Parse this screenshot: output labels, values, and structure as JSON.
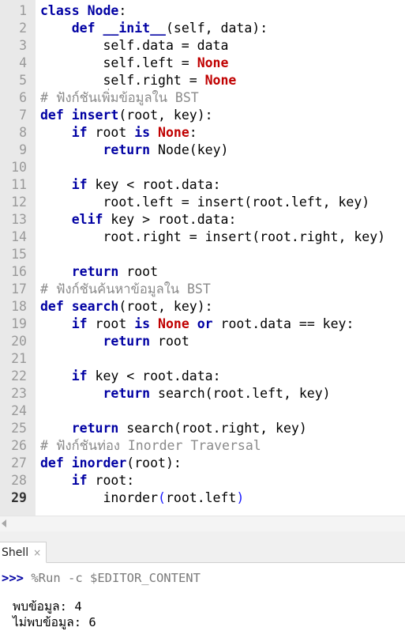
{
  "editor": {
    "current_line": 29,
    "lines": [
      {
        "n": 1,
        "tokens": [
          {
            "t": "class",
            "c": "kw"
          },
          {
            "t": " "
          },
          {
            "t": "Node",
            "c": "kw"
          },
          {
            "t": ":"
          }
        ]
      },
      {
        "n": 2,
        "tokens": [
          {
            "t": "    "
          },
          {
            "t": "def",
            "c": "kw"
          },
          {
            "t": " "
          },
          {
            "t": "__init__",
            "c": "kw"
          },
          {
            "t": "(self, data):"
          }
        ]
      },
      {
        "n": 3,
        "tokens": [
          {
            "t": "        self.data = data"
          }
        ]
      },
      {
        "n": 4,
        "tokens": [
          {
            "t": "        self.left = "
          },
          {
            "t": "None",
            "c": "kc"
          }
        ]
      },
      {
        "n": 5,
        "tokens": [
          {
            "t": "        self.right = "
          },
          {
            "t": "None",
            "c": "kc"
          }
        ]
      },
      {
        "n": 6,
        "tokens": [
          {
            "t": "# ฟังก์ชันเพิ่มข้อมูลใน BST",
            "c": "comment"
          }
        ]
      },
      {
        "n": 7,
        "tokens": [
          {
            "t": "def",
            "c": "kw"
          },
          {
            "t": " "
          },
          {
            "t": "insert",
            "c": "kw"
          },
          {
            "t": "(root, key):"
          }
        ]
      },
      {
        "n": 8,
        "tokens": [
          {
            "t": "    "
          },
          {
            "t": "if",
            "c": "kw"
          },
          {
            "t": " root "
          },
          {
            "t": "is",
            "c": "kw"
          },
          {
            "t": " "
          },
          {
            "t": "None",
            "c": "kc"
          },
          {
            "t": ":"
          }
        ]
      },
      {
        "n": 9,
        "tokens": [
          {
            "t": "        "
          },
          {
            "t": "return",
            "c": "kw"
          },
          {
            "t": " Node(key)"
          }
        ]
      },
      {
        "n": 10,
        "tokens": []
      },
      {
        "n": 11,
        "tokens": [
          {
            "t": "    "
          },
          {
            "t": "if",
            "c": "kw"
          },
          {
            "t": " key < root.data:"
          }
        ]
      },
      {
        "n": 12,
        "tokens": [
          {
            "t": "        root.left = insert(root.left, key)"
          }
        ]
      },
      {
        "n": 13,
        "tokens": [
          {
            "t": "    "
          },
          {
            "t": "elif",
            "c": "kw"
          },
          {
            "t": " key > root.data:"
          }
        ]
      },
      {
        "n": 14,
        "tokens": [
          {
            "t": "        root.right = insert(root.right, key)"
          }
        ]
      },
      {
        "n": 15,
        "tokens": []
      },
      {
        "n": 16,
        "tokens": [
          {
            "t": "    "
          },
          {
            "t": "return",
            "c": "kw"
          },
          {
            "t": " root"
          }
        ]
      },
      {
        "n": 17,
        "tokens": [
          {
            "t": "# ฟังก์ชันค้นหาข้อมูลใน BST",
            "c": "comment"
          }
        ]
      },
      {
        "n": 18,
        "tokens": [
          {
            "t": "def",
            "c": "kw"
          },
          {
            "t": " "
          },
          {
            "t": "search",
            "c": "kw"
          },
          {
            "t": "(root, key):"
          }
        ]
      },
      {
        "n": 19,
        "tokens": [
          {
            "t": "    "
          },
          {
            "t": "if",
            "c": "kw"
          },
          {
            "t": " root "
          },
          {
            "t": "is",
            "c": "kw"
          },
          {
            "t": " "
          },
          {
            "t": "None",
            "c": "kc"
          },
          {
            "t": " "
          },
          {
            "t": "or",
            "c": "kw"
          },
          {
            "t": " root.data == key:"
          }
        ]
      },
      {
        "n": 20,
        "tokens": [
          {
            "t": "        "
          },
          {
            "t": "return",
            "c": "kw"
          },
          {
            "t": " root"
          }
        ]
      },
      {
        "n": 21,
        "tokens": []
      },
      {
        "n": 22,
        "tokens": [
          {
            "t": "    "
          },
          {
            "t": "if",
            "c": "kw"
          },
          {
            "t": " key < root.data:"
          }
        ]
      },
      {
        "n": 23,
        "tokens": [
          {
            "t": "        "
          },
          {
            "t": "return",
            "c": "kw"
          },
          {
            "t": " search(root.left, key)"
          }
        ]
      },
      {
        "n": 24,
        "tokens": []
      },
      {
        "n": 25,
        "tokens": [
          {
            "t": "    "
          },
          {
            "t": "return",
            "c": "kw"
          },
          {
            "t": " search(root.right, key)"
          }
        ]
      },
      {
        "n": 26,
        "tokens": [
          {
            "t": "# ฟังก์ชันท่อง Inorder Traversal",
            "c": "comment"
          }
        ]
      },
      {
        "n": 27,
        "tokens": [
          {
            "t": "def",
            "c": "kw"
          },
          {
            "t": " "
          },
          {
            "t": "inorder",
            "c": "kw"
          },
          {
            "t": "(root):"
          }
        ]
      },
      {
        "n": 28,
        "tokens": [
          {
            "t": "    "
          },
          {
            "t": "if",
            "c": "kw"
          },
          {
            "t": " root:"
          }
        ]
      },
      {
        "n": 29,
        "tokens": [
          {
            "t": "        inorder"
          },
          {
            "t": "(",
            "c": "paren"
          },
          {
            "t": "root.left"
          },
          {
            "t": ")",
            "c": "paren"
          }
        ]
      }
    ]
  },
  "shell": {
    "tab_label": "Shell",
    "tab_close": "×",
    "prompt": ">>>",
    "command": " %Run -c $EDITOR_CONTENT",
    "output": [
      "พบข้อมูล: 4",
      "ไม่พบข้อมูล: 6"
    ]
  }
}
